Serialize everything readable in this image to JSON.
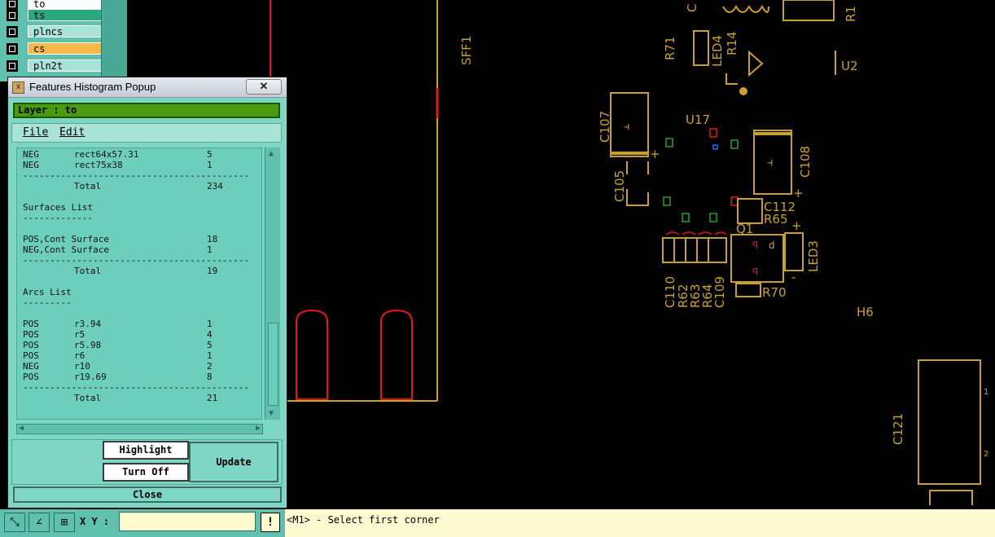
{
  "layers": [
    {
      "name": "to",
      "color": "#4a9a10"
    },
    {
      "name": "ts",
      "color": "#2aa880"
    },
    {
      "name": "plncs",
      "color": "#a9e2d6"
    },
    {
      "name": "cs",
      "color": "#f5b84a"
    },
    {
      "name": "pln2t",
      "color": "#a9e2d6"
    }
  ],
  "popup": {
    "title": "Features Histogram Popup",
    "close_glyph": "✕",
    "layer_header": "Layer :  to",
    "menu": {
      "file": "File",
      "edit": "Edit"
    },
    "lines": [
      {
        "a": "NEG",
        "b": "rect64x57.31",
        "c": "5"
      },
      {
        "a": "NEG",
        "b": "rect75x38",
        "c": "1"
      },
      {
        "sep": "------------------------------------------"
      },
      {
        "a": "",
        "b": "Total",
        "c": "234"
      },
      {
        "a": "",
        "b": "",
        "c": ""
      },
      {
        "a": "Surfaces List",
        "b": "",
        "c": ""
      },
      {
        "sep": "-------------"
      },
      {
        "a": "",
        "b": "",
        "c": ""
      },
      {
        "a": "POS,Cont Surface",
        "b": "",
        "c": "18"
      },
      {
        "a": "NEG,Cont Surface",
        "b": "",
        "c": "1"
      },
      {
        "sep": "------------------------------------------"
      },
      {
        "a": "",
        "b": "Total",
        "c": "19"
      },
      {
        "a": "",
        "b": "",
        "c": ""
      },
      {
        "a": "Arcs List",
        "b": "",
        "c": ""
      },
      {
        "sep": "---------"
      },
      {
        "a": "",
        "b": "",
        "c": ""
      },
      {
        "a": "POS",
        "b": "r3.94",
        "c": "1"
      },
      {
        "a": "POS",
        "b": "r5",
        "c": "4"
      },
      {
        "a": "POS",
        "b": "r5.98",
        "c": "5"
      },
      {
        "a": "POS",
        "b": "r6",
        "c": "1"
      },
      {
        "a": "NEG",
        "b": "r10",
        "c": "2"
      },
      {
        "a": "POS",
        "b": "r19.69",
        "c": "8"
      },
      {
        "sep": "------------------------------------------"
      },
      {
        "a": "",
        "b": "Total",
        "c": "21"
      }
    ],
    "buttons": {
      "highlight": "Highlight",
      "turn_off": "Turn Off",
      "update": "Update",
      "close": "Close"
    }
  },
  "status": {
    "xy_label": "X Y :",
    "xy_value": "",
    "warn_glyph": "!",
    "message": "<M1> - Select first corner"
  },
  "pcb_labels": {
    "sff1": "SFF1",
    "u2": "U2",
    "r71": "R71",
    "led4": "LED4",
    "r14": "R14",
    "u17": "U17",
    "c107": "C107",
    "c108": "C108",
    "c105": "C105",
    "c112": "C112",
    "r65": "R65",
    "q1": "Q1",
    "led3": "LED3",
    "c110": "C110",
    "r62": "R62",
    "r63": "R63",
    "r64": "R64",
    "c109": "C109",
    "r70": "R70",
    "h6": "H6",
    "c121": "C121",
    "pin1": "1",
    "pin2": "2"
  },
  "colors": {
    "silk": "#c8a030",
    "pad_red": "#e01818",
    "panel": "#7fd6c4"
  }
}
